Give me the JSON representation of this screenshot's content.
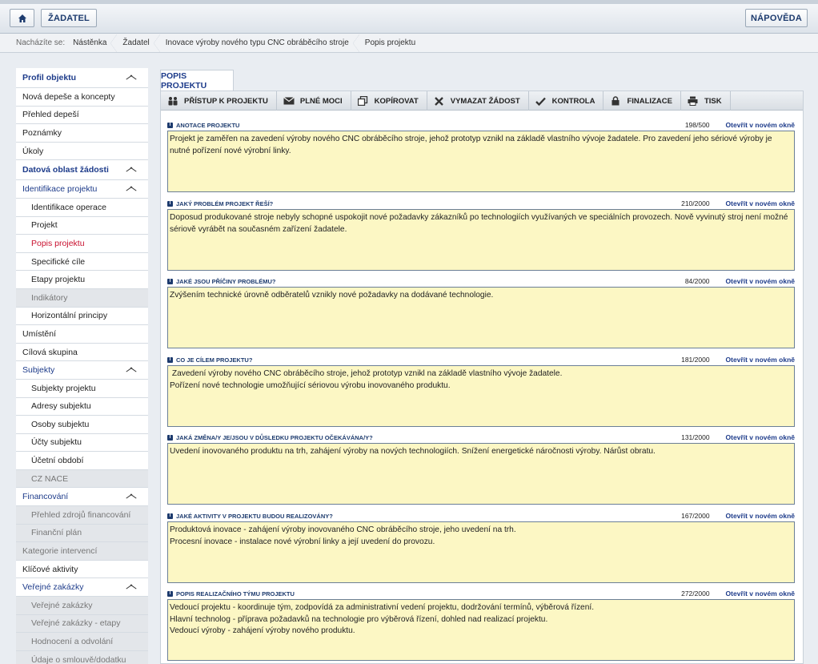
{
  "topbar": {
    "zadatel_label": "ŽADATEL",
    "help_label": "NÁPOVĚDA"
  },
  "breadcrumb": {
    "label": "Nacházíte se:",
    "items": [
      "Nástěnka",
      "Žadatel",
      "Inovace výroby nového typu CNC obráběcího stroje",
      "Popis projektu"
    ]
  },
  "sidebar": {
    "items": [
      {
        "label": "Profil objektu"
      },
      {
        "label": "Nová depeše a koncepty"
      },
      {
        "label": "Přehled depeší"
      },
      {
        "label": "Poznámky"
      },
      {
        "label": "Úkoly"
      },
      {
        "label": "Datová oblast žádosti"
      },
      {
        "label": "Identifikace projektu"
      },
      {
        "label": "Identifikace operace"
      },
      {
        "label": "Projekt"
      },
      {
        "label": "Popis projektu"
      },
      {
        "label": "Specifické cíle"
      },
      {
        "label": "Etapy projektu"
      },
      {
        "label": "Indikátory"
      },
      {
        "label": "Horizontální principy"
      },
      {
        "label": "Umístění"
      },
      {
        "label": "Cílová skupina"
      },
      {
        "label": "Subjekty"
      },
      {
        "label": "Subjekty projektu"
      },
      {
        "label": "Adresy subjektu"
      },
      {
        "label": "Osoby subjektu"
      },
      {
        "label": "Účty subjektu"
      },
      {
        "label": "Účetní období"
      },
      {
        "label": "CZ NACE"
      },
      {
        "label": "Financování"
      },
      {
        "label": "Přehled zdrojů financování"
      },
      {
        "label": "Finanční plán"
      },
      {
        "label": "Kategorie intervencí"
      },
      {
        "label": "Klíčové aktivity"
      },
      {
        "label": "Veřejné zakázky"
      },
      {
        "label": "Veřejné zakázky"
      },
      {
        "label": "Veřejné zakázky - etapy"
      },
      {
        "label": "Hodnocení a odvolání"
      },
      {
        "label": "Údaje o smlouvě/dodatku"
      }
    ]
  },
  "tab": {
    "label": "POPIS PROJEKTU"
  },
  "toolbar": {
    "buttons": [
      "PŘÍSTUP K PROJEKTU",
      "PLNÉ MOCI",
      "KOPÍROVAT",
      "VYMAZAT ŽÁDOST",
      "KONTROLA",
      "FINALIZACE",
      "TISK"
    ]
  },
  "fields": [
    {
      "label": "ANOTACE PROJEKTU",
      "count": "198/500",
      "link": "Otevřít v novém okně",
      "value": "Projekt je zaměřen na zavedení výroby nového CNC obráběcího stroje, jehož prototyp vznikl na základě vlastního vývoje žadatele. Pro zavedení jeho sériové výroby je nutné pořízení nové výrobní linky."
    },
    {
      "label": "JAKÝ PROBLÉM PROJEKT ŘEŠÍ?",
      "count": "210/2000",
      "link": "Otevřít v novém okně",
      "value": "Doposud produkované stroje nebyly schopné uspokojit nové požadavky zákazníků po technologiích využívaných ve speciálních provozech. Nově vyvinutý stroj není možné sériově vyrábět na současném zařízení žadatele."
    },
    {
      "label": "JAKÉ JSOU PŘÍČINY PROBLÉMU?",
      "count": "84/2000",
      "link": "Otevřít v novém okně",
      "value": "Zvýšením technické úrovně odběratelů vznikly nové požadavky na dodávané technologie."
    },
    {
      "label": "CO JE CÍLEM PROJEKTU?",
      "count": "181/2000",
      "link": "Otevřít v novém okně",
      "value": " Zavedení výroby nového CNC obráběcího stroje, jehož prototyp vznikl na základě vlastního vývoje žadatele.\nPořízení nové technologie umožňující sériovou výrobu inovovaného produktu."
    },
    {
      "label": "JAKÁ ZMĚNA/Y JE/JSOU V DŮSLEDKU PROJEKTU OČEKÁVÁNA/Y?",
      "count": "131/2000",
      "link": "Otevřít v novém okně",
      "value": "Uvedení inovovaného produktu na trh, zahájení výroby na nových technologiích. Snížení energetické náročnosti výroby. Nárůst obratu."
    },
    {
      "label": "JAKÉ AKTIVITY V PROJEKTU BUDOU REALIZOVÁNY?",
      "count": "167/2000",
      "link": "Otevřít v novém okně",
      "value": "Produktová inovace - zahájení výroby inovovaného CNC obráběcího stroje, jeho uvedení na trh.\nProcesní inovace - instalace nové výrobní linky a její uvedení do provozu."
    },
    {
      "label": "POPIS REALIZAČNÍHO TÝMU PROJEKTU",
      "count": "272/2000",
      "link": "Otevřít v novém okně",
      "value": "Vedoucí projektu - koordinuje tým, zodpovídá za administrativní vedení projektu, dodržování termínů, výběrová řízení.\nHlavní technolog - příprava požadavků na technologie pro výběrová řízení, dohled nad realizací projektu.\nVedoucí výroby - zahájení výroby nového produktu."
    }
  ]
}
